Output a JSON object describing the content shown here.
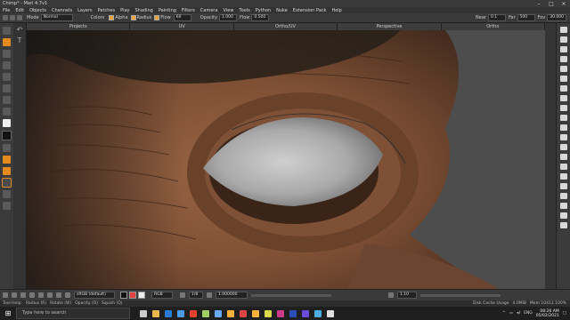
{
  "window": {
    "title": "Chimp* - Mari 4.7v1"
  },
  "menu": [
    "File",
    "Edit",
    "Objects",
    "Channels",
    "Layers",
    "Patches",
    "Play",
    "Shading",
    "Painting",
    "Filters",
    "Camera",
    "View",
    "Tools",
    "Python",
    "Nuke",
    "Extension Pack",
    "Help"
  ],
  "toolbar": {
    "mode_label": "Mode",
    "mode_value": "Normal",
    "colors_label": "Colors",
    "alpha_label": "Alpha",
    "radius_label": "Radius",
    "flow_label": "Flow",
    "radius_value": "60",
    "opacity_label": "Opacity",
    "opacity_value": "1.000",
    "flow2_label": "Flow",
    "flow2_value": "0.500",
    "near_label": "Near",
    "near_value": "0.1",
    "far_label": "Far",
    "far_value": "500",
    "fov_label": "Fov",
    "fov_value": "30.000"
  },
  "tabs": [
    "Projects",
    "UV",
    "Ortho/UV",
    "Perspective",
    "Ortho"
  ],
  "status": {
    "colorspace": "sRGB (default)",
    "channel": "RGB",
    "size_value": "1/8",
    "value_value": "1.000000",
    "zoom_value": "1.10"
  },
  "help": {
    "tool_help": "Tool Help:",
    "radius": "Radius (R)",
    "rotate": "Rotate (W)",
    "opacity": "Opacity (O)",
    "squish": "Squish (Q)",
    "cache": "Disk Cache Usage",
    "cache_value": "4.0MiB",
    "mem": "Mem 10411 100%"
  },
  "taskbar": {
    "search_placeholder": "Type here to search",
    "lang": "ENG",
    "time": "08:26 AM",
    "date": "05/02/2021"
  },
  "colors": {
    "accent": "#e38a1c",
    "skin": "#8a5a3c",
    "viewport_bg": "#4d4d4d"
  }
}
